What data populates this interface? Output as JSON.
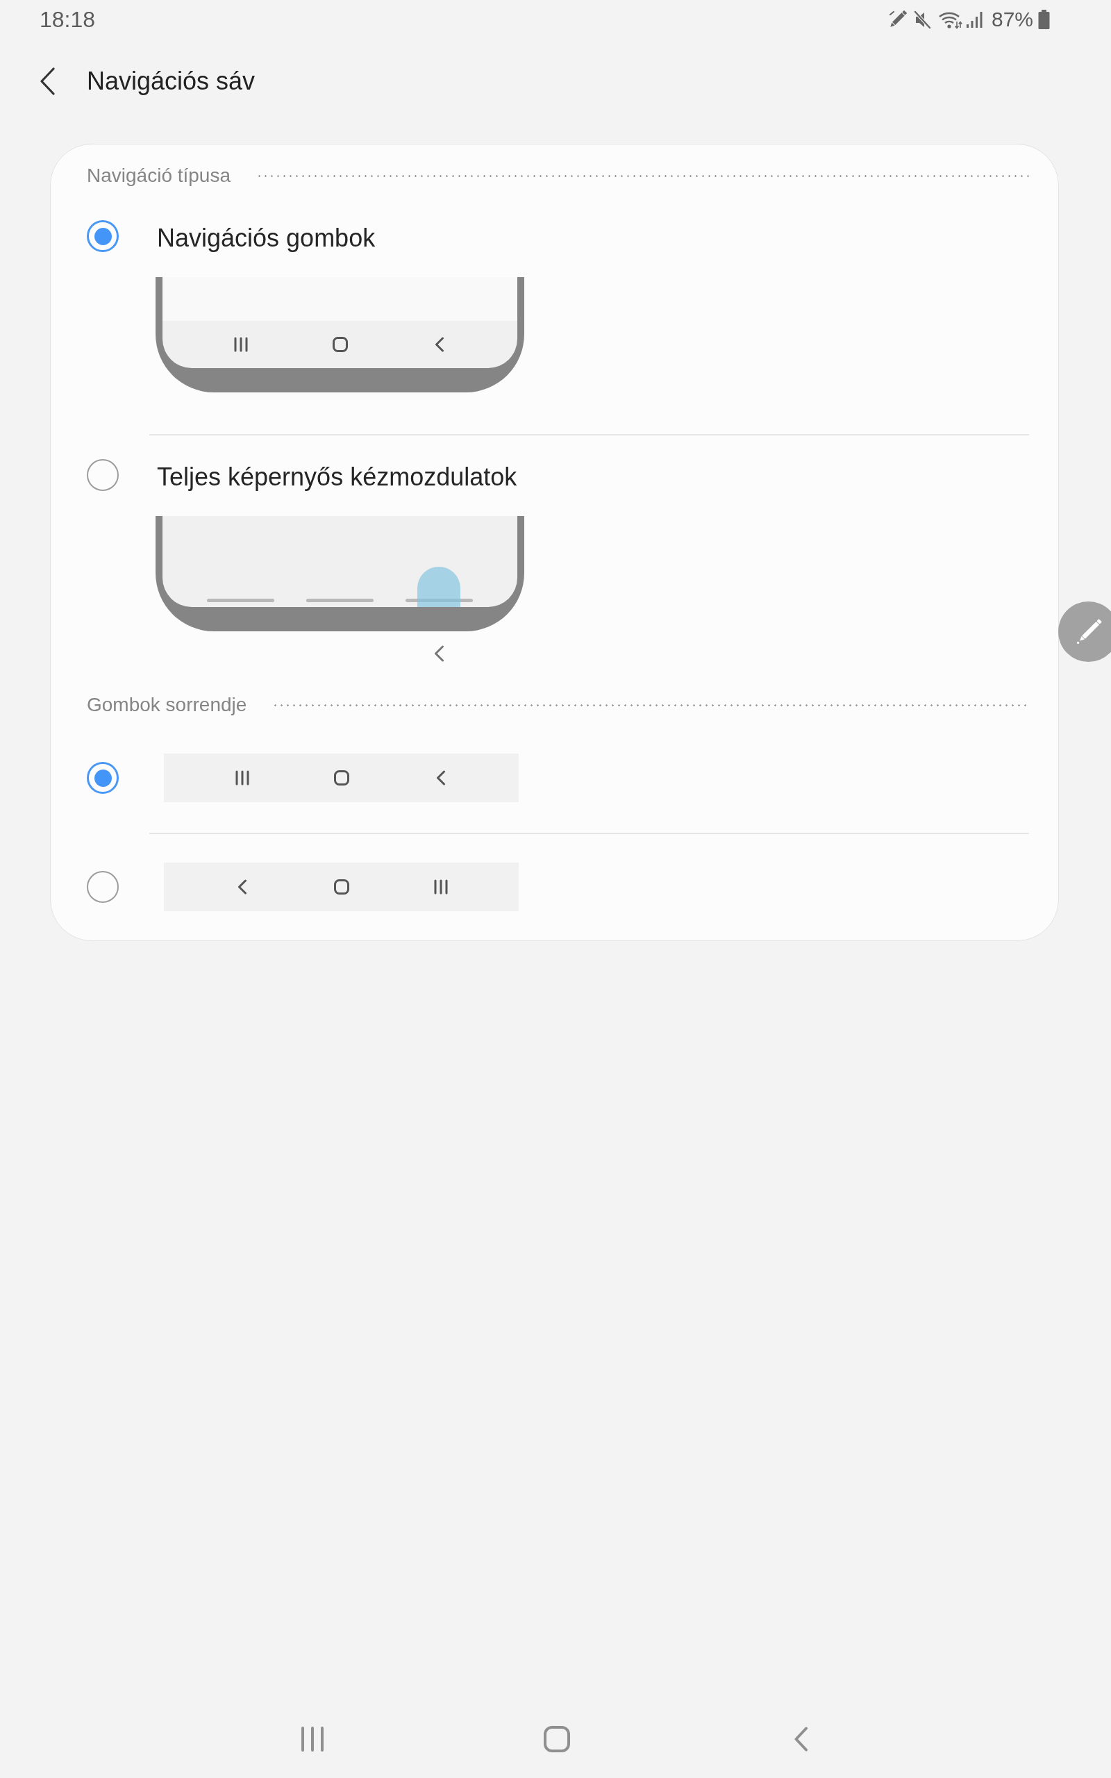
{
  "status_bar": {
    "time": "18:18",
    "battery": "87%"
  },
  "header": {
    "title": "Navigációs sáv"
  },
  "sections": [
    {
      "title": "Navigáció típusa",
      "options": [
        {
          "kind": "buttons_preview",
          "label": "Navigációs gombok",
          "selected": true
        },
        {
          "kind": "gesture_preview",
          "label": "Teljes képernyős kézmozdulatok",
          "selected": false
        }
      ]
    },
    {
      "title": "Gombok sorrendje",
      "options": [
        {
          "kind": "order_bar",
          "selected": true,
          "buttons": [
            {
              "kind": "recents"
            },
            {
              "kind": "home"
            },
            {
              "kind": "back"
            }
          ]
        },
        {
          "kind": "order_bar",
          "selected": false,
          "buttons": [
            {
              "kind": "back"
            },
            {
              "kind": "home"
            },
            {
              "kind": "recents"
            }
          ]
        }
      ]
    }
  ],
  "nav_bar": {
    "buttons": [
      {
        "kind": "recents"
      },
      {
        "kind": "home"
      },
      {
        "kind": "back"
      }
    ]
  }
}
